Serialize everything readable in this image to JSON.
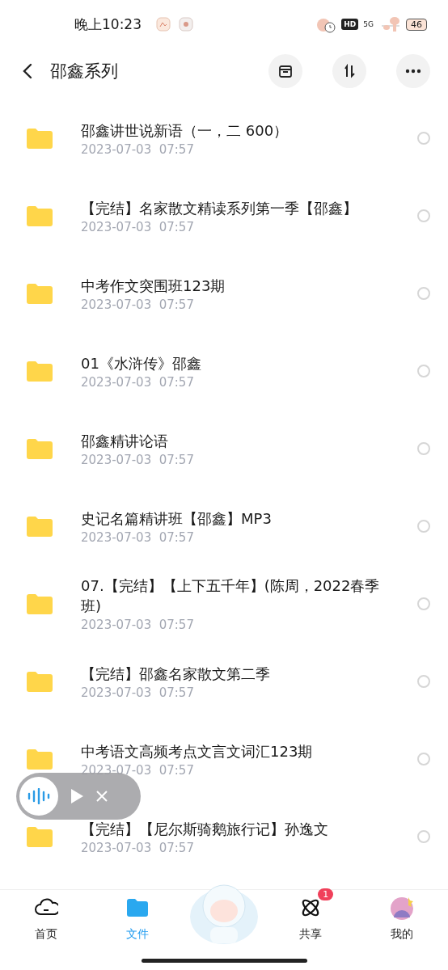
{
  "status_bar": {
    "time": "晚上10:23",
    "hd": "HD",
    "network": "5G",
    "battery": "46"
  },
  "header": {
    "title": "邵鑫系列"
  },
  "files": [
    {
      "name": "邵鑫讲世说新语（一，二  600）",
      "date": "2023-07-03  07:57",
      "selected": false
    },
    {
      "name": "【完结】名家散文精读系列第一季【邵鑫】",
      "date": "2023-07-03  07:57",
      "selected": false
    },
    {
      "name": "中考作文突围班123期",
      "date": "2023-07-03  07:57",
      "selected": false
    },
    {
      "name": "01《水浒传》邵鑫",
      "date": "2023-07-03  07:57",
      "selected": false
    },
    {
      "name": "邵鑫精讲论语",
      "date": "2023-07-03  07:57",
      "selected": false
    },
    {
      "name": "史记名篇精讲班【邵鑫】MP3",
      "date": "2023-07-03  07:57",
      "selected": false
    },
    {
      "name": "07.【完结】【上下五千年】(陈周，2022春季班)",
      "date": "2023-07-03  07:57",
      "selected": false
    },
    {
      "name": "【完结】邵鑫名家散文第二季",
      "date": "2023-07-03  07:57",
      "selected": false
    },
    {
      "name": "中考语文高频考点文言文词汇123期",
      "date": "2023-07-03  07:57",
      "selected": false
    },
    {
      "name": "【完结】【尼尔斯骑鹅旅行记】孙逸文",
      "date": "2023-07-03  07:57",
      "selected": false
    }
  ],
  "nav": [
    {
      "kind": "home",
      "label": "首页",
      "selected": false
    },
    {
      "kind": "files",
      "label": "文件",
      "selected": true
    },
    {
      "kind": "mascot"
    },
    {
      "kind": "share",
      "label": "共享",
      "selected": false,
      "badge": "1"
    },
    {
      "kind": "profile",
      "label": "我的",
      "selected": false
    }
  ]
}
